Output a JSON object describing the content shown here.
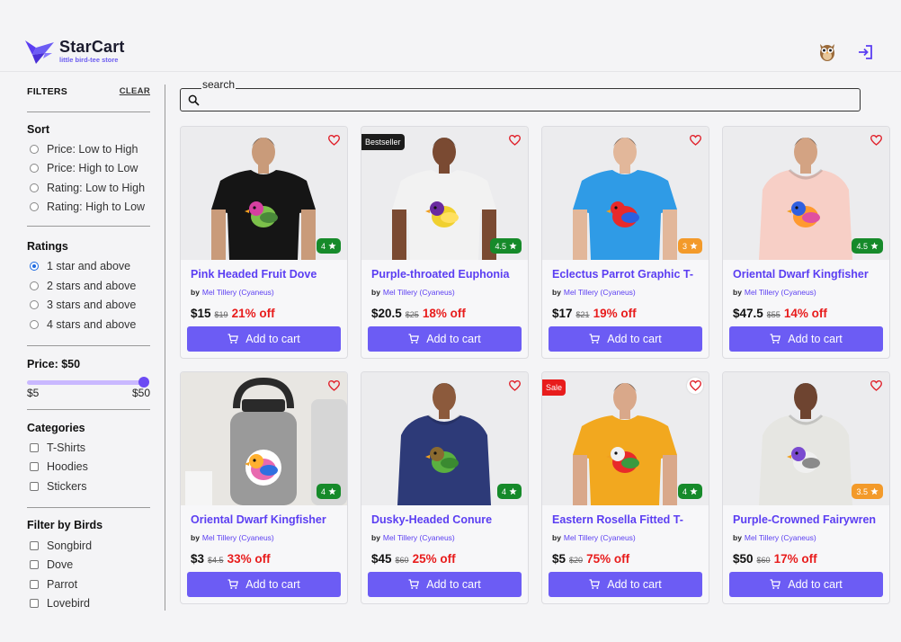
{
  "header": {
    "brand": "StarCart",
    "tagline": "little bird-tee store"
  },
  "sidebar": {
    "title": "FILTERS",
    "clear": "CLEAR",
    "sort": {
      "title": "Sort",
      "options": [
        "Price: Low to High",
        "Price: High to Low",
        "Rating: Low to High",
        "Rating: High to Low"
      ]
    },
    "ratings": {
      "title": "Ratings",
      "options": [
        "1 star and above",
        "2 stars and above",
        "3 stars and above",
        "4 stars and above"
      ],
      "selected_index": 0
    },
    "price": {
      "title": "Price: $50",
      "min": "$5",
      "max": "$50",
      "value_fraction": 1.0
    },
    "categories": {
      "title": "Categories",
      "options": [
        "T-Shirts",
        "Hoodies",
        "Stickers"
      ]
    },
    "birds": {
      "title": "Filter by Birds",
      "options": [
        "Songbird",
        "Dove",
        "Parrot",
        "Lovebird"
      ]
    }
  },
  "search": {
    "label": "search",
    "value": ""
  },
  "colors": {
    "accent": "#6c5cf4",
    "title_purple": "#5b3ef2",
    "discount_red": "#e81c1c",
    "rating_green": "#168a2a",
    "rating_orange": "#f39a2a"
  },
  "products": [
    {
      "title": "Pink Headed Fruit Dove",
      "by": "by",
      "artist": "Mel Tillery (Cyaneus)",
      "price": "$15",
      "old_price": "$19",
      "discount": "21% off",
      "rating": "4",
      "rating_color": "green",
      "badge": "",
      "button": "Add to cart",
      "product_type": "t-shirt",
      "garment_color": "#151515"
    },
    {
      "title": "Purple-throated Euphonia",
      "by": "by",
      "artist": "Mel Tillery (Cyaneus)",
      "price": "$20.5",
      "old_price": "$25",
      "discount": "18% off",
      "rating": "4.5",
      "rating_color": "green",
      "badge": "Bestseller",
      "button": "Add to cart",
      "product_type": "t-shirt",
      "garment_color": "#f2f2f2"
    },
    {
      "title": "Eclectus Parrot Graphic T-",
      "by": "by",
      "artist": "Mel Tillery (Cyaneus)",
      "price": "$17",
      "old_price": "$21",
      "discount": "19% off",
      "rating": "3",
      "rating_color": "orange",
      "badge": "",
      "button": "Add to cart",
      "product_type": "t-shirt",
      "garment_color": "#2f9be6"
    },
    {
      "title": "Oriental Dwarf Kingfisher",
      "by": "by",
      "artist": "Mel Tillery (Cyaneus)",
      "price": "$47.5",
      "old_price": "$55",
      "discount": "14% off",
      "rating": "4.5",
      "rating_color": "green",
      "badge": "",
      "button": "Add to cart",
      "product_type": "hoodie",
      "garment_color": "#f7cfc6"
    },
    {
      "title": "Oriental Dwarf Kingfisher",
      "by": "by",
      "artist": "Mel Tillery (Cyaneus)",
      "price": "$3",
      "old_price": "$4.5",
      "discount": "33% off",
      "rating": "4",
      "rating_color": "green",
      "badge": "",
      "button": "Add to cart",
      "product_type": "sticker",
      "garment_color": "#9a9a9a"
    },
    {
      "title": "Dusky-Headed Conure",
      "by": "by",
      "artist": "Mel Tillery (Cyaneus)",
      "price": "$45",
      "old_price": "$60",
      "discount": "25% off",
      "rating": "4",
      "rating_color": "green",
      "badge": "",
      "button": "Add to cart",
      "product_type": "hoodie",
      "garment_color": "#2d3a78"
    },
    {
      "title": "Eastern Rosella Fitted T-",
      "by": "by",
      "artist": "Mel Tillery (Cyaneus)",
      "price": "$5",
      "old_price": "$20",
      "discount": "75% off",
      "rating": "4",
      "rating_color": "green",
      "badge": "Sale",
      "button": "Add to cart",
      "product_type": "t-shirt",
      "garment_color": "#f2a81f"
    },
    {
      "title": "Purple-Crowned Fairywren",
      "by": "by",
      "artist": "Mel Tillery (Cyaneus)",
      "price": "$50",
      "old_price": "$60",
      "discount": "17% off",
      "rating": "3.5",
      "rating_color": "orange",
      "badge": "",
      "button": "Add to cart",
      "product_type": "hoodie",
      "garment_color": "#e6e6e2"
    }
  ]
}
